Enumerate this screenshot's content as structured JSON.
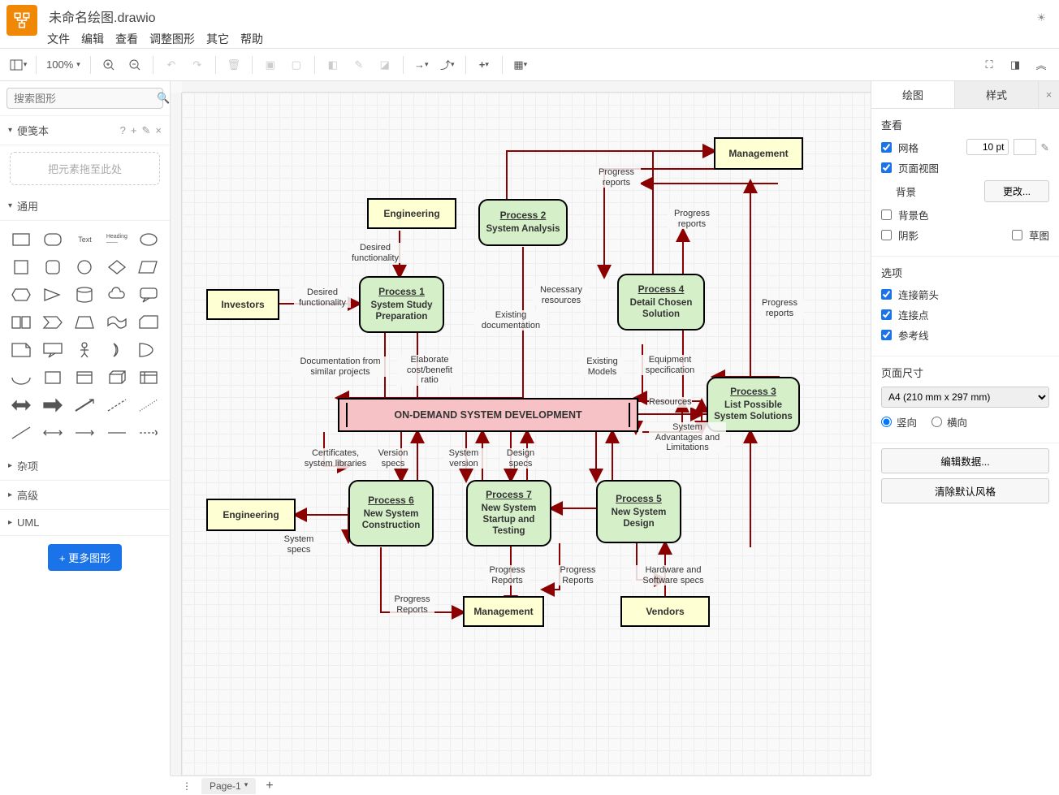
{
  "title": "未命名绘图.drawio",
  "menu": {
    "file": "文件",
    "edit": "编辑",
    "view": "查看",
    "adjust": "调整图形",
    "other": "其它",
    "help": "帮助"
  },
  "toolbar": {
    "zoom": "100%"
  },
  "sidebar": {
    "search_placeholder": "搜索图形",
    "scratch": "便笺本",
    "dropzone": "把元素拖至此处",
    "general": "通用",
    "misc": "杂项",
    "advanced": "高级",
    "uml": "UML",
    "more": "+ 更多图形"
  },
  "right": {
    "tabs": {
      "draw": "绘图",
      "style": "样式"
    },
    "view": {
      "h": "查看",
      "grid": "网格",
      "grid_val": "10 pt",
      "pageview": "页面视图",
      "bg": "背景",
      "change": "更改...",
      "bgcolor": "背景色",
      "shadow": "阴影",
      "sketch": "草图"
    },
    "options": {
      "h": "选项",
      "arrows": "连接箭头",
      "points": "连接点",
      "guides": "参考线"
    },
    "pagesize": {
      "h": "页面尺寸",
      "preset": "A4 (210 mm x 297 mm)",
      "portrait": "竖向",
      "landscape": "横向"
    },
    "editdata": "编辑数据...",
    "cleardefault": "清除默认风格"
  },
  "footer": {
    "page": "Page-1"
  },
  "diagram": {
    "investors": "Investors",
    "engineering": "Engineering",
    "engineering2": "Engineering",
    "management": "Management",
    "management2": "Management",
    "vendors": "Vendors",
    "ondemand": "ON-DEMAND SYSTEM DEVELOPMENT",
    "p1": {
      "t": "Process 1",
      "d": "System Study Preparation"
    },
    "p2": {
      "t": "Process 2",
      "d": "System Analysis"
    },
    "p3": {
      "t": "Process 3",
      "d": "List Possible System Solutions"
    },
    "p4": {
      "t": "Process 4",
      "d": "Detail Chosen Solution"
    },
    "p5": {
      "t": "Process 5",
      "d": "New System Design"
    },
    "p6": {
      "t": "Process 6",
      "d": "New System Construction"
    },
    "p7": {
      "t": "Process 7",
      "d": "New System Startup and Testing"
    },
    "lbl": {
      "desired1": "Desired functionality",
      "desired2": "Desired functionality",
      "docsim": "Documentation from similar projects",
      "elab": "Elaborate cost/benefit ratio",
      "existdoc": "Existing documentation",
      "necres": "Necessary resources",
      "existmod": "Existing Models",
      "equip": "Equipment specification",
      "res": "Resources",
      "sysadv": "System Advantages and Limitations",
      "prog1": "Progress reports",
      "prog2": "Progress reports",
      "prog3": "Progress reports",
      "prog4": "Progress Reports",
      "prog5": "Progress Reports",
      "prog6": "Progress Reports",
      "cert": "Certificates, system libraries",
      "verspec": "Version specs",
      "sysver": "System version",
      "despec": "Design specs",
      "sysspec": "System specs",
      "hwsw": "Hardware and Software specs"
    }
  }
}
